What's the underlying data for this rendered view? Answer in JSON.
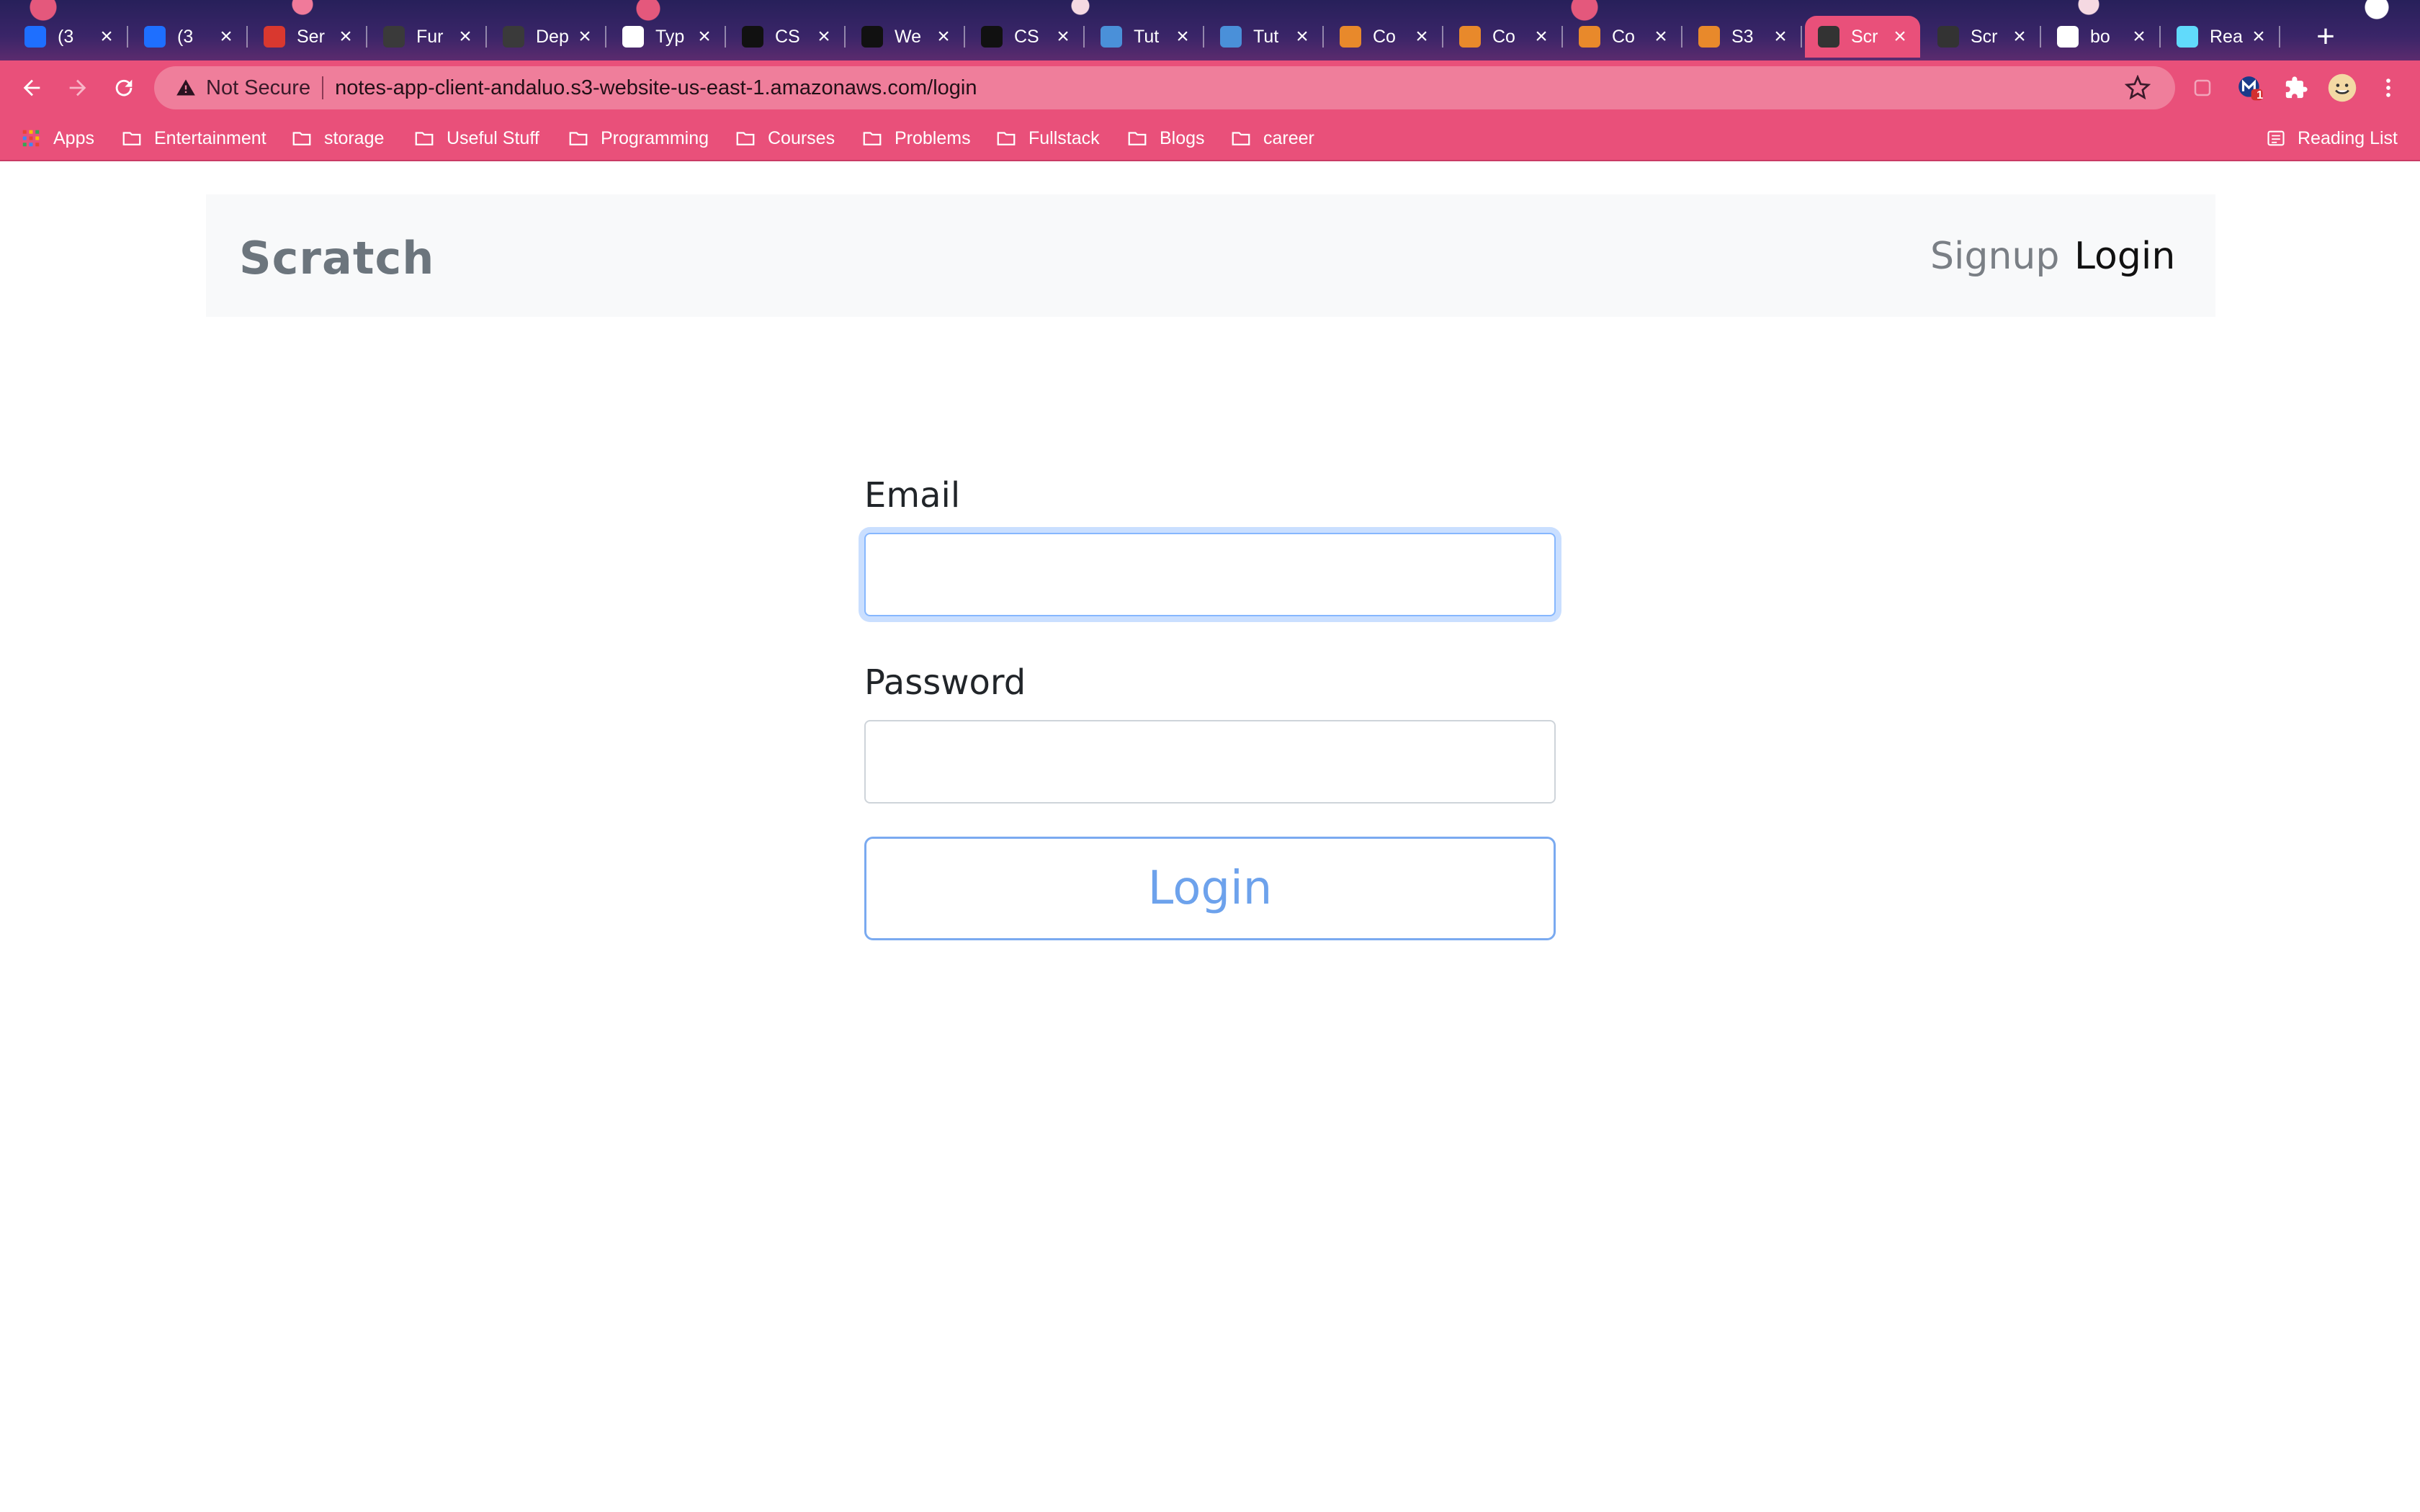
{
  "browser": {
    "tabs": [
      {
        "label": "(3",
        "favicon": "zhihu-icon",
        "color": "#1e6fff"
      },
      {
        "label": "(3",
        "favicon": "zhihu-icon",
        "color": "#1e6fff"
      },
      {
        "label": "Ser",
        "favicon": "serverless-icon",
        "color": "#d9382f"
      },
      {
        "label": "Fur",
        "favicon": "globe-icon",
        "color": "#3a3a3a"
      },
      {
        "label": "Dep",
        "favicon": "globe-icon",
        "color": "#3a3a3a"
      },
      {
        "label": "Typ",
        "favicon": "triangle-icon",
        "color": "#ffffff"
      },
      {
        "label": "CS",
        "favicon": "github-icon",
        "color": "#111111"
      },
      {
        "label": "We",
        "favicon": "github-icon",
        "color": "#111111"
      },
      {
        "label": "CS",
        "favicon": "github-icon",
        "color": "#111111"
      },
      {
        "label": "Tut",
        "favicon": "box-icon",
        "color": "#4a90d9"
      },
      {
        "label": "Tut",
        "favicon": "box-icon",
        "color": "#4a90d9"
      },
      {
        "label": "Co",
        "favicon": "aws-cube-icon",
        "color": "#e8892b"
      },
      {
        "label": "Co",
        "favicon": "aws-cube-icon",
        "color": "#e8892b"
      },
      {
        "label": "Co",
        "favicon": "aws-cube-icon",
        "color": "#e8892b"
      },
      {
        "label": "S3",
        "favicon": "aws-cube-icon",
        "color": "#e8892b"
      },
      {
        "label": "Scr",
        "favicon": "pencil-icon",
        "color": "#333333",
        "active": true
      },
      {
        "label": "Scr",
        "favicon": "pencil-icon",
        "color": "#333333"
      },
      {
        "label": "bo",
        "favicon": "google-icon",
        "color": "#ffffff"
      },
      {
        "label": "Rea",
        "favicon": "react-icon",
        "color": "#61dafb"
      }
    ],
    "address": {
      "security_label": "Not Secure",
      "url": "notes-app-client-andaluo.s3-website-us-east-1.amazonaws.com/login"
    },
    "extension_badge": "1",
    "bookmarks": [
      "Apps",
      "Entertainment",
      "storage",
      "Useful Stuff",
      "Programming",
      "Courses",
      "Problems",
      "Fullstack",
      "Blogs",
      "career"
    ],
    "reading_list": "Reading List",
    "accent_color": "#e9507a"
  },
  "page": {
    "navbar": {
      "brand": "Scratch",
      "links": {
        "signup": "Signup",
        "login": "Login"
      }
    },
    "form": {
      "email_label": "Email",
      "email_value": "",
      "password_label": "Password",
      "password_value": "",
      "submit_label": "Login"
    }
  }
}
